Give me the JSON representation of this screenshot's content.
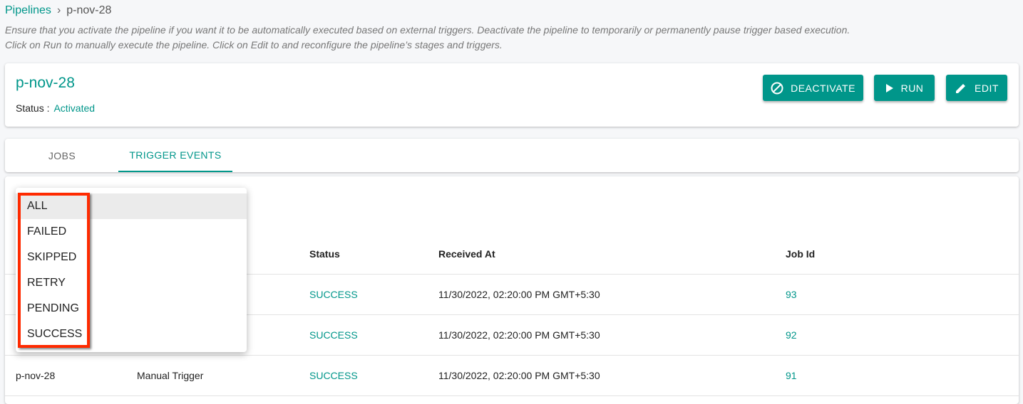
{
  "breadcrumb": {
    "root": "Pipelines",
    "separator": "›",
    "current": "p-nov-28"
  },
  "description": [
    "Ensure that you activate the pipeline if you want it to be automatically executed based on external triggers. Deactivate the pipeline to temporarily or permanently pause trigger based execution.",
    "Click on Run to manually execute the pipeline. Click on Edit to and reconfigure the pipeline’s stages and triggers."
  ],
  "pipeline": {
    "name": "p-nov-28",
    "status_label": "Status :",
    "status_value": "Activated"
  },
  "buttons": {
    "deactivate": "DEACTIVATE",
    "run": "RUN",
    "edit": "EDIT"
  },
  "tabs": [
    {
      "label": "JOBS"
    },
    {
      "label": "TRIGGER EVENTS",
      "active": true
    }
  ],
  "table": {
    "headers": {
      "status": "Status",
      "received_at": "Received At",
      "job_id": "Job Id"
    },
    "rows": [
      {
        "pipeline": "",
        "trigger": "",
        "status": "SUCCESS",
        "received_at": "11/30/2022, 02:20:00 PM GMT+5:30",
        "job_id": "93"
      },
      {
        "pipeline": "",
        "trigger": "",
        "status": "SUCCESS",
        "received_at": "11/30/2022, 02:20:00 PM GMT+5:30",
        "job_id": "92"
      },
      {
        "pipeline": "p-nov-28",
        "trigger": "Manual Trigger",
        "status": "SUCCESS",
        "received_at": "11/30/2022, 02:20:00 PM GMT+5:30",
        "job_id": "91"
      }
    ]
  },
  "status_filter": {
    "options": [
      "ALL",
      "FAILED",
      "SKIPPED",
      "RETRY",
      "PENDING",
      "SUCCESS"
    ],
    "selected": "ALL"
  },
  "colors": {
    "accent": "#00968a",
    "highlight": "#ff2a00"
  }
}
